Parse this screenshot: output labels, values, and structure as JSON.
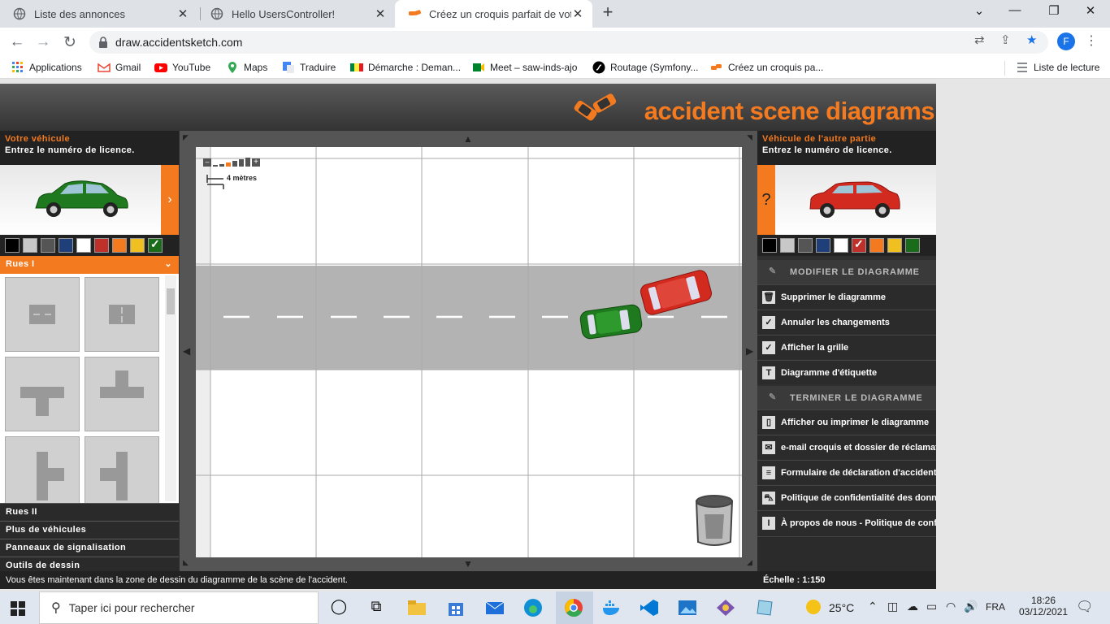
{
  "browser": {
    "tabs": [
      {
        "title": "Liste des annonces",
        "active": false
      },
      {
        "title": "Hello UsersController!",
        "active": false
      },
      {
        "title": "Créez un croquis parfait de votre",
        "active": true
      }
    ],
    "url": "draw.accidentsketch.com",
    "profile_initial": "F",
    "bookmarks": [
      {
        "label": "Applications",
        "icon": "apps-grid-icon"
      },
      {
        "label": "Gmail",
        "icon": "gmail-icon"
      },
      {
        "label": "YouTube",
        "icon": "youtube-icon"
      },
      {
        "label": "Maps",
        "icon": "maps-icon"
      },
      {
        "label": "Traduire",
        "icon": "translate-icon"
      },
      {
        "label": "Démarche : Deman...",
        "icon": "senegal-flag-icon"
      },
      {
        "label": "Meet – saw-inds-ajo",
        "icon": "meet-icon"
      },
      {
        "label": "Routage (Symfony...",
        "icon": "symfony-icon"
      },
      {
        "label": "Créez un croquis pa...",
        "icon": "accident-icon"
      }
    ],
    "reading_list": "Liste de lecture"
  },
  "app": {
    "logo_text": "accident scene diagrams",
    "left": {
      "title": "Votre véhicule",
      "subtitle": "Entrez le numéro de licence.",
      "car_color": "#1f7a1f",
      "categories": [
        "Rues I",
        "Rues II",
        "Plus de véhicules",
        "Panneaux de signalisation",
        "Outils de dessin"
      ]
    },
    "right": {
      "title": "Véhicule de l'autre partie",
      "subtitle": "Entrez le numéro de licence.",
      "car_color": "#d22a1f",
      "question": "?",
      "section1": "MODIFIER LE DIAGRAMME",
      "items1": [
        {
          "label": "Supprimer le diagramme",
          "icon": "trash-icon"
        },
        {
          "label": "Annuler les changements",
          "icon": "undo-check-icon"
        },
        {
          "label": "Afficher la grille",
          "icon": "grid-check-icon"
        },
        {
          "label": "Diagramme d'étiquette",
          "icon": "text-label-icon"
        }
      ],
      "section2": "TERMINER LE DIAGRAMME",
      "items2": [
        {
          "label": "Afficher ou imprimer le diagramme",
          "icon": "document-icon"
        },
        {
          "label": "e-mail croquis et dossier de réclamation",
          "icon": "email-icon"
        },
        {
          "label": "Formulaire de déclaration d'accident",
          "icon": "form-icon"
        },
        {
          "label": "Politique de confidentialité des données",
          "icon": "car-privacy-icon"
        },
        {
          "label": "À propos de nous - Politique de confidentialité",
          "icon": "info-icon"
        }
      ]
    },
    "swatches": [
      "#000000",
      "#c8c8c8",
      "#555555",
      "#1f3f7a",
      "#ffffff",
      "#c0302a",
      "#f47a20",
      "#f0c020",
      "#1a6b1a"
    ],
    "scale_label": "4 mètres",
    "status": "Vous êtes maintenant dans la zone de dessin du diagramme de la scène de l'accident.",
    "scale": "Échelle : 1:150",
    "colors": {
      "accent": "#f47a20",
      "dark": "#2b2b2b"
    }
  },
  "taskbar": {
    "search_placeholder": "Taper ici pour rechercher",
    "temperature": "25°C",
    "language": "FRA",
    "time": "18:26",
    "date": "03/12/2021"
  }
}
